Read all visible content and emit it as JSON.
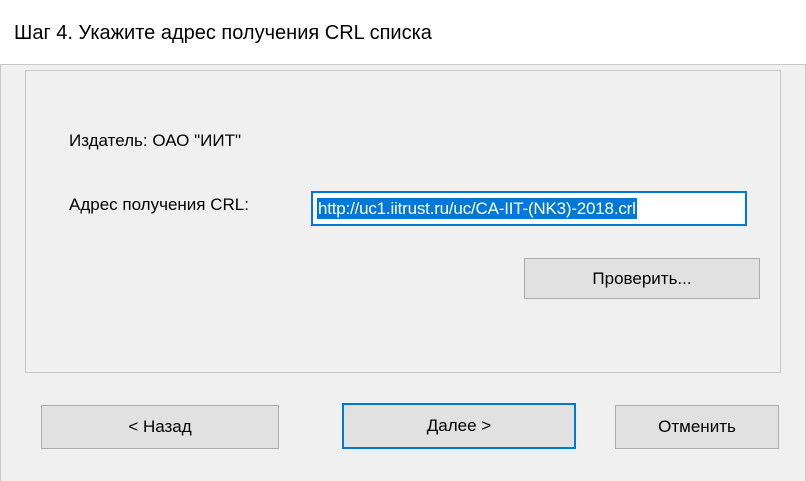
{
  "dialog": {
    "title": "Шаг 4. Укажите адрес получения CRL списка"
  },
  "form": {
    "publisher_text": "Издатель: ОАО \"ИИТ\"",
    "crl_address_label": "Адрес получения CRL:",
    "crl_address_value": "http://uc1.iitrust.ru/uc/CA-IIT-(NK3)-2018.crl",
    "check_button_label": "Проверить..."
  },
  "footer": {
    "back_label": "< Назад",
    "next_label": "Далее >",
    "cancel_label": "Отменить"
  },
  "colors": {
    "accent": "#0078d7",
    "button_face": "#e1e1e1",
    "window_bg": "#f0f0f0",
    "header_bg": "#ffffff"
  }
}
